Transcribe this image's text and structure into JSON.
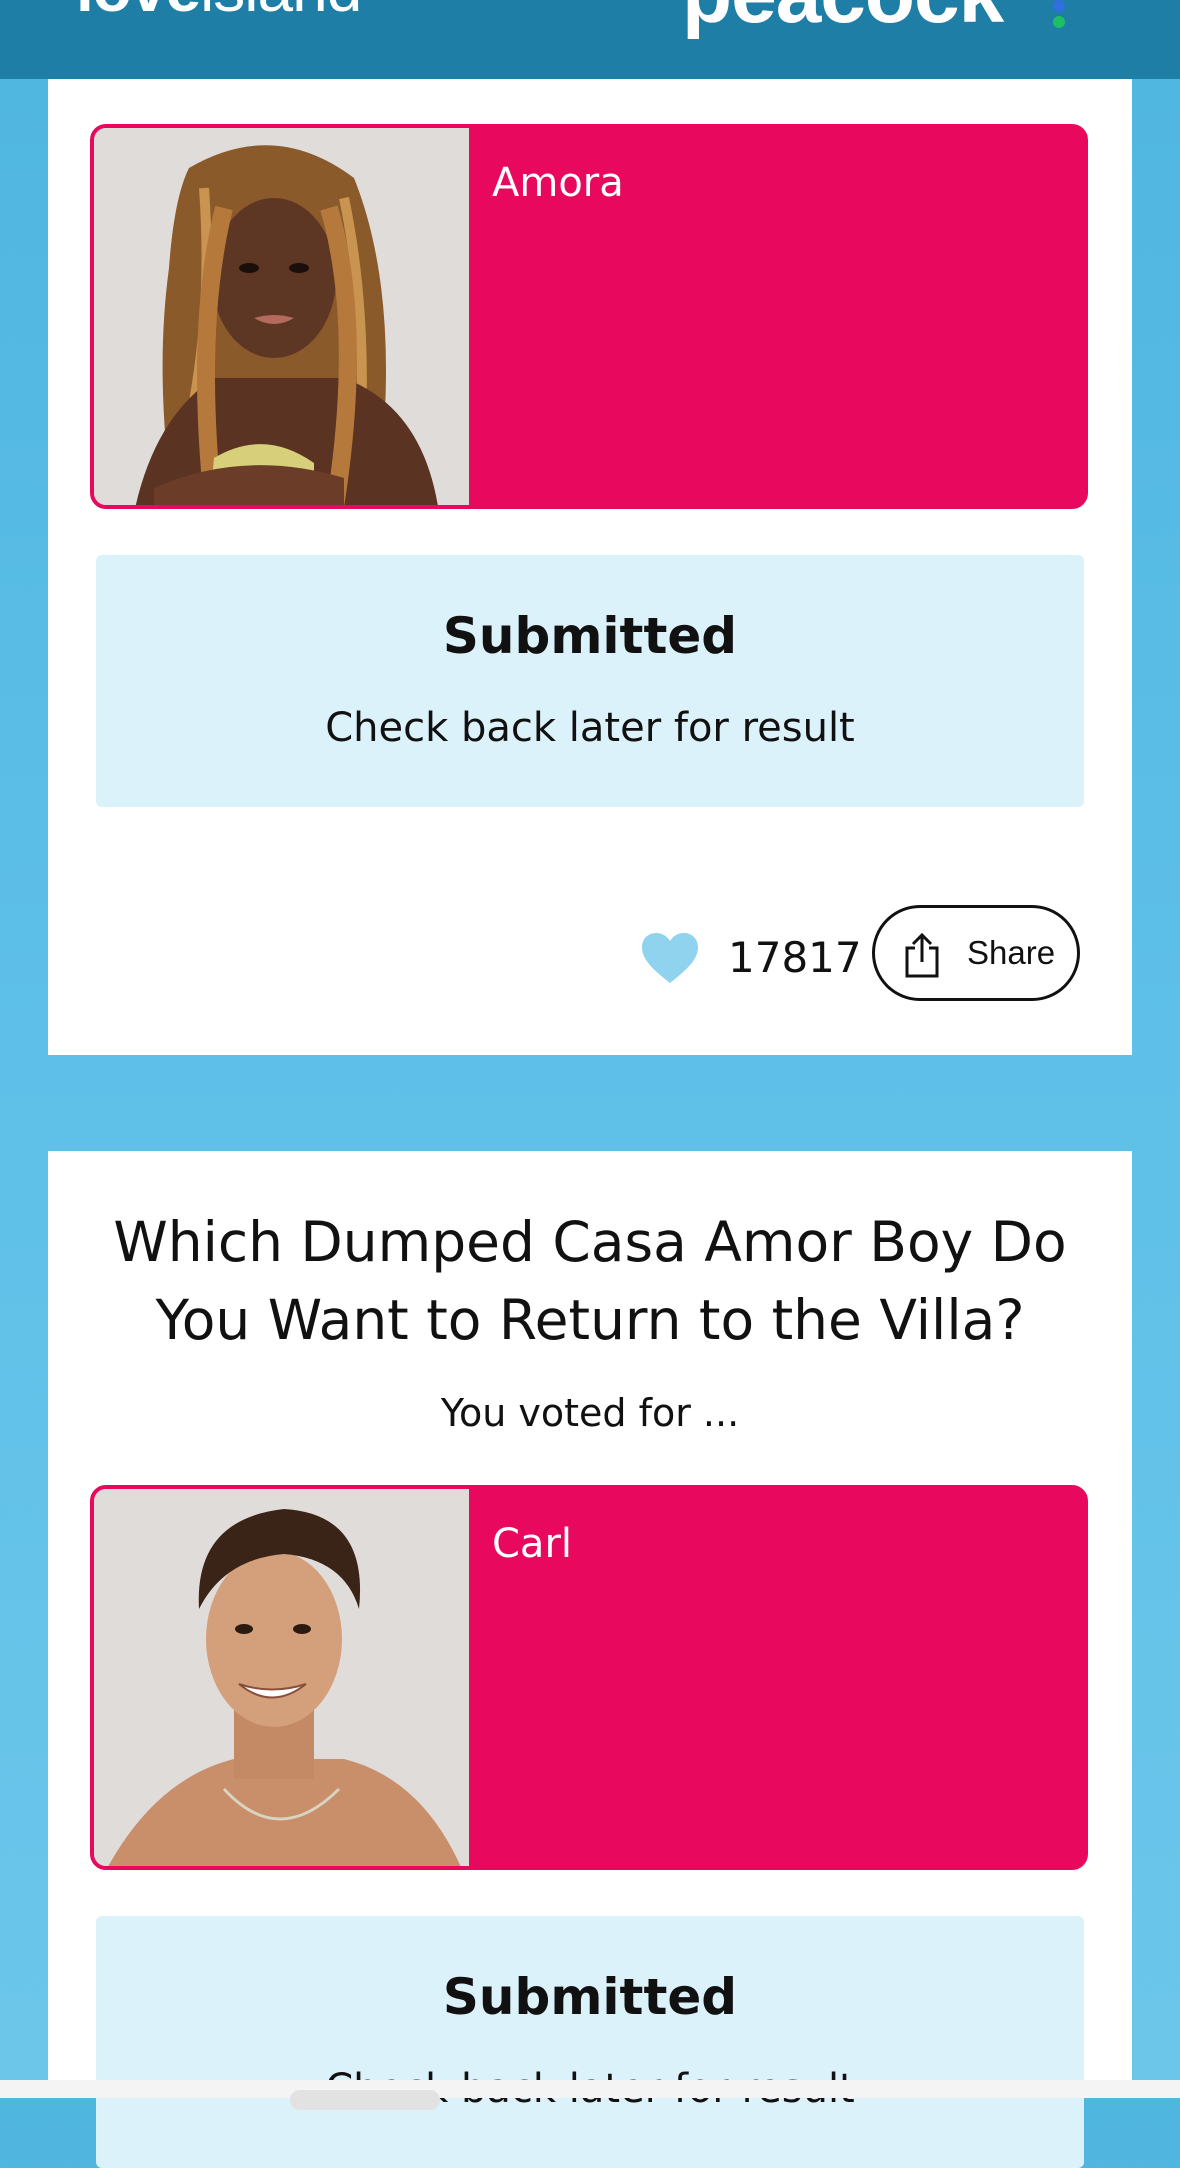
{
  "header": {
    "brand_left_bold": "love",
    "brand_left_light": "island",
    "brand_right": "peacock",
    "bar_color": "#1e7ea6"
  },
  "poll_1": {
    "selection_name": "Amora",
    "status_title": "Submitted",
    "status_subtitle": "Check back later for result",
    "like_icon": "heart-icon",
    "like_count": "17817",
    "share_label": "Share",
    "share_icon": "share-icon"
  },
  "poll_2": {
    "question": "Which Dumped Casa Amor Boy Do You Want to Return to the Villa?",
    "voted_for_label": "You voted for ...",
    "selection_name": "Carl",
    "status_title": "Submitted",
    "status_subtitle": "Check back later for result"
  },
  "colors": {
    "accent_pink": "#e8085e",
    "status_bg": "#dbf2fb",
    "heart": "#8fd3ef",
    "page_bg": "#5ec0e8"
  }
}
